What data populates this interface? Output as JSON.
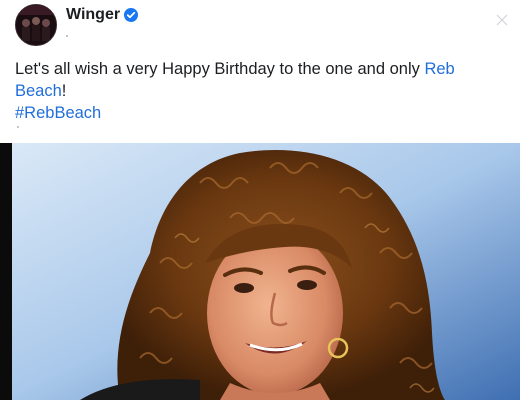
{
  "post": {
    "author": "Winger",
    "verified_icon": "verified-badge-icon",
    "text_before": "Let's all wish a very Happy Birthday to the one and only ",
    "mention": "Reb Beach",
    "text_after": "!",
    "hashtag": "#RebBeach"
  },
  "colors": {
    "link": "#216fdb",
    "text": "#1c1e21",
    "verified": "#1877f2"
  }
}
